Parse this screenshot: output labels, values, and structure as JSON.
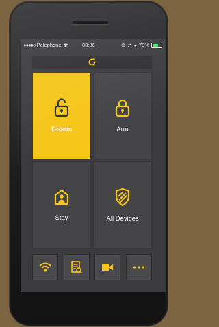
{
  "status": {
    "carrier": "Pelephone",
    "time": "03:36",
    "battery": "70%",
    "battery_level": 0.7
  },
  "toolbar": {
    "refresh_icon": "refresh-icon"
  },
  "tiles": [
    {
      "label": "Disarm",
      "icon": "unlock-icon",
      "active": true
    },
    {
      "label": "Arm",
      "icon": "lock-icon",
      "active": false
    },
    {
      "label": "Stay",
      "icon": "home-person-icon",
      "active": false
    },
    {
      "label": "All Devices",
      "icon": "shield-icon",
      "active": false
    }
  ],
  "tabs": [
    {
      "icon": "wifi-icon"
    },
    {
      "icon": "log-search-icon"
    },
    {
      "icon": "video-camera-icon"
    },
    {
      "icon": "more-icon"
    }
  ],
  "colors": {
    "accent": "#f5c518",
    "tile": "#444446",
    "screen": "#3b3b3d",
    "frame": "#1d1d1f",
    "background": "#7d6440"
  }
}
